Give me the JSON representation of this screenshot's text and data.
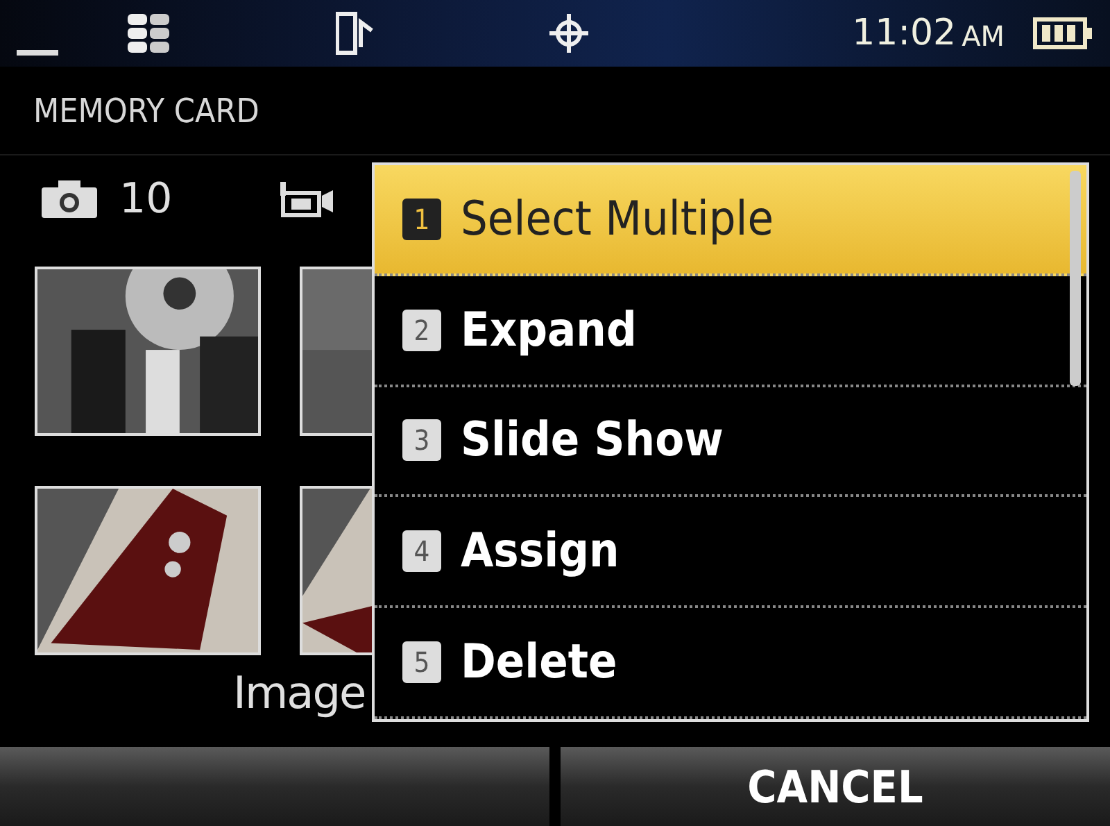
{
  "status_bar": {
    "time": "11:02",
    "ampm": "AM"
  },
  "header": {
    "title": "MEMORY CARD"
  },
  "counts": {
    "photos": "10"
  },
  "filename": "Image",
  "menu": {
    "items": [
      {
        "number": "1",
        "label": "Select Multiple",
        "selected": true
      },
      {
        "number": "2",
        "label": "Expand",
        "selected": false
      },
      {
        "number": "3",
        "label": "Slide Show",
        "selected": false
      },
      {
        "number": "4",
        "label": "Assign",
        "selected": false
      },
      {
        "number": "5",
        "label": "Delete",
        "selected": false
      }
    ]
  },
  "softkeys": {
    "right": "CANCEL"
  }
}
